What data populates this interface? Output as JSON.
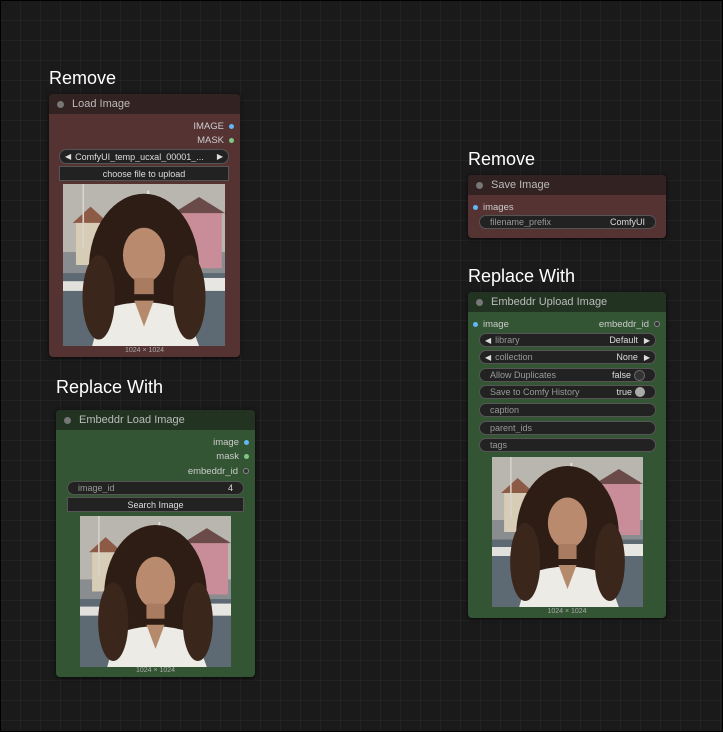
{
  "labels": {
    "remove_left": "Remove",
    "remove_right": "Remove",
    "replace_left": "Replace With",
    "replace_right": "Replace With"
  },
  "colors": {
    "remove_node_body": "#553333",
    "remove_node_title": "#332222",
    "replace_node_body": "#335533",
    "replace_node_title": "#223322",
    "image_slot": "#64b5f6",
    "mask_slot": "#81c784"
  },
  "load_image": {
    "title": "Load Image",
    "outputs": [
      "IMAGE",
      "MASK"
    ],
    "image_select": "ComfyUI_temp_ucxal_00001_...",
    "upload_button": "choose file to upload",
    "image_size": "1024 × 1024"
  },
  "embeddr_load": {
    "title": "Embeddr Load Image",
    "outputs": [
      "image",
      "mask",
      "embeddr_id"
    ],
    "image_id_label": "image_id",
    "image_id_value": "4",
    "search_button": "Search Image",
    "image_size": "1024 × 1024"
  },
  "save_image": {
    "title": "Save Image",
    "input": "images",
    "prefix_label": "filename_prefix",
    "prefix_value": "ComfyUI"
  },
  "embeddr_upload": {
    "title": "Embeddr Upload Image",
    "input": "image",
    "output": "embeddr_id",
    "library_label": "library",
    "library_value": "Default",
    "collection_label": "collection",
    "collection_value": "None",
    "allow_dup_label": "Allow Duplicates",
    "allow_dup_value": "false",
    "save_history_label": "Save to Comfy History",
    "save_history_value": "true",
    "caption_label": "caption",
    "parent_ids_label": "parent_ids",
    "tags_label": "tags",
    "image_size": "1024 × 1024"
  }
}
